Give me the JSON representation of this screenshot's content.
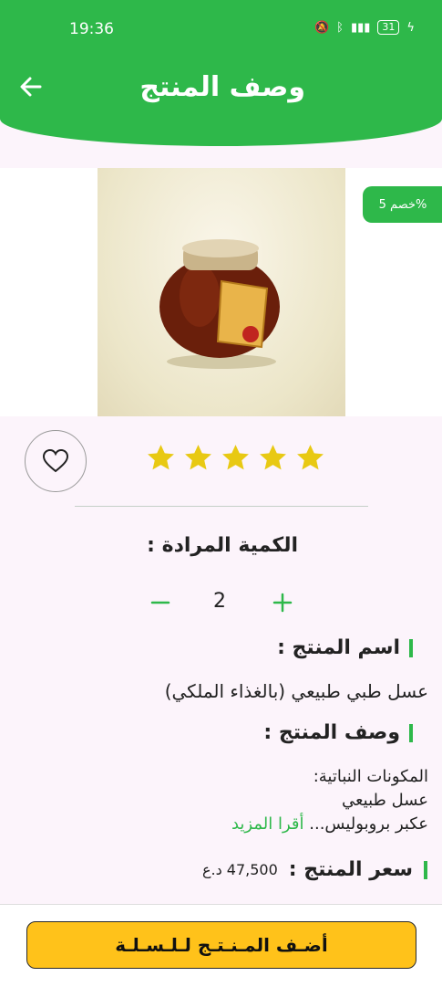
{
  "status_bar": {
    "time": "19:36",
    "battery": "31"
  },
  "header": {
    "title": "وصف المنتج"
  },
  "product": {
    "discount_badge": "خصم 5%",
    "rating": 5,
    "quantity_label": "الكمية المرادة :",
    "quantity": "2",
    "name_label": "اسم المنتج :",
    "name": "عسل طبي طبيعي (بالغذاء الملكي)",
    "description_label": "وصف المنتج :",
    "description_lines": [
      "المكونات النباتية:",
      "عسل طبيعي",
      "عكبر بروبوليس..."
    ],
    "read_more": "أقرا المزيد",
    "price_label": "سعر المنتج :",
    "price": "47,500 د.ع"
  },
  "actions": {
    "add_to_cart": "أضـف المـنـتـج لـلـسـلـة"
  },
  "colors": {
    "brand_green": "#2eb84a",
    "cart_button": "#ffc21a",
    "star": "#e8c913"
  }
}
